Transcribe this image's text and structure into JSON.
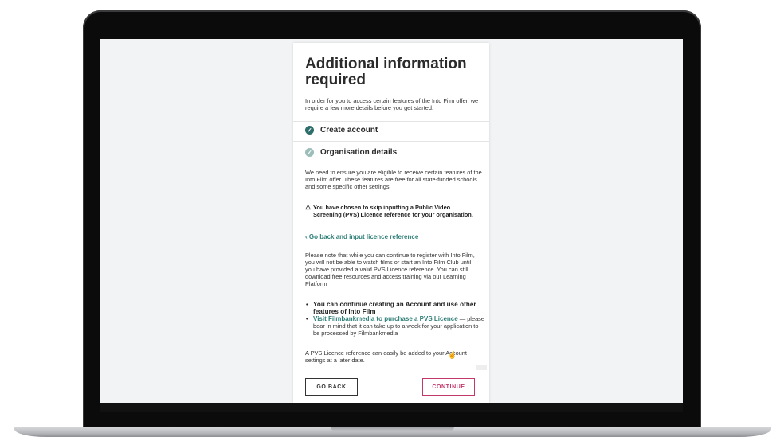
{
  "modal": {
    "title": "Additional information required",
    "intro": "In order for you to access certain features of the Into Film offer, we require a few more details before you get started.",
    "steps": [
      {
        "label": "Create account",
        "status": "complete"
      },
      {
        "label": "Organisation details",
        "status": "in-progress"
      }
    ],
    "org_text": "We need to ensure you are eligible to receive certain features of the Into Film offer. These features are free for all state-funded schools and some specific other settings.",
    "warning": "You have chosen to skip inputting a Public Video Screening (PVS) Licence reference for your organisation.",
    "back_link": "Go back and input licence reference",
    "note": "Please note that while you can continue to register with Into Film, you will not be able to watch films or start an Into Film Club until you have provided a valid PVS Licence reference. You can still download free resources and access training via our Learning Platform",
    "bullets": {
      "first": "You can continue creating an Account and use other features of Into Film",
      "second_link": "Visit Filmbankmedia to purchase a PVS Licence",
      "second_rest": " — please bear in mind that it can take up to a week for your application to be processed by Filmbankmedia"
    },
    "later_note": "A PVS Licence reference can easily be added to your Account settings at a later date.",
    "buttons": {
      "back": "GO BACK",
      "continue": "CONTINUE"
    }
  },
  "icons": {
    "warning": "⚠",
    "chevron_left": "‹",
    "check": "✓"
  },
  "colors": {
    "teal": "#2f7f78",
    "check_done": "#2f6f6b",
    "check_pending": "#9dbdbb",
    "continue_accent": "#c2386a"
  }
}
